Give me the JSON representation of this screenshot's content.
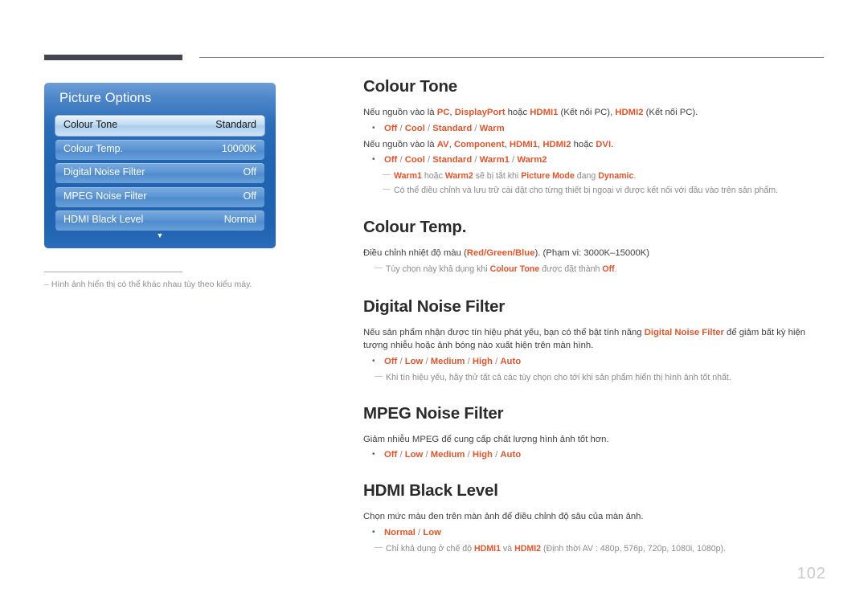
{
  "header": {
    "rule_dark_color": "#45454f",
    "rule_thin_color": "#7a7a84"
  },
  "osd": {
    "title": "Picture Options",
    "scroll_down_icon": "chevron-down-icon",
    "rows": [
      {
        "label": "Colour Tone",
        "value": "Standard",
        "selected": true
      },
      {
        "label": "Colour Temp.",
        "value": "10000K",
        "selected": false
      },
      {
        "label": "Digital Noise Filter",
        "value": "Off",
        "selected": false
      },
      {
        "label": "MPEG Noise Filter",
        "value": "Off",
        "selected": false
      },
      {
        "label": "HDMI Black Level",
        "value": "Normal",
        "selected": false
      }
    ],
    "caption_dash": "–",
    "caption": "Hình ảnh hiển thị có thể khác nhau tùy theo kiểu máy."
  },
  "colors": {
    "accent_orange": "#e2542a",
    "body_text": "#3f3f3f",
    "note_text": "#8b8b8b",
    "heading": "#2b2b2b",
    "osd_blue": "#1f63b1",
    "page_number": "#c9c9cf"
  },
  "sections": {
    "colour_tone": {
      "heading": "Colour Tone",
      "p1_a": "Nếu nguồn vào là ",
      "p1_pc": "PC",
      "p1_b": ", ",
      "p1_displayport": "DisplayPort",
      "p1_c": " hoặc ",
      "p1_hdmi1": "HDMI1",
      "p1_d": " (Kết nối PC), ",
      "p1_hdmi2": "HDMI2",
      "p1_e": " (Kết nối PC).",
      "bullet1": "Off / Cool / Standard / Warm",
      "p2_a": "Nếu nguồn vào là ",
      "p2_av": "AV",
      "p2_b": ", ",
      "p2_component": "Component",
      "p2_c": ", ",
      "p2_hdmi1": "HDMI1",
      "p2_d": ", ",
      "p2_hdmi2": "HDMI2",
      "p2_e": "  hoặc ",
      "p2_dvi": "DVI",
      "p2_f": ".",
      "bullet2": "Off / Cool / Standard / Warm1 / Warm2",
      "note1_warm1": "Warm1",
      "note1_a": " hoặc ",
      "note1_warm2": "Warm2",
      "note1_b": " sẽ bị tắt khi ",
      "note1_picturemode": "Picture Mode",
      "note1_c": " đang ",
      "note1_dynamic": "Dynamic",
      "note1_d": ".",
      "note2": "Có thể điều chỉnh và lưu trữ cài đặt cho từng thiết bị ngoại vi được kết nối với đầu vào trên sản phẩm."
    },
    "colour_temp": {
      "heading": "Colour Temp.",
      "p1_a": "Điều chỉnh nhiệt độ màu (",
      "p1_rgb": "Red/Green/Blue",
      "p1_b": "). (Phạm vi: 3000K–15000K)",
      "note1_a": "Tùy chọn này khả dụng khi ",
      "note1_colourtone": "Colour Tone",
      "note1_b": " được đặt thành ",
      "note1_off": "Off",
      "note1_c": "."
    },
    "digital_noise_filter": {
      "heading": "Digital Noise Filter",
      "p1_a": "Nếu sản phẩm nhận được tín hiệu phát yếu, bạn có thể bật tính năng ",
      "p1_dnf": "Digital Noise Filter",
      "p1_b": " để giảm bất kỳ hiện tượng nhiễu hoặc ảnh bóng nào xuất hiện trên màn hình.",
      "bullet1": "Off / Low / Medium / High / Auto",
      "note1": "Khi tín hiệu yếu, hãy thử tất cả các tùy chọn cho tới khi sản phẩm hiển thị hình ảnh tốt nhất."
    },
    "mpeg_noise_filter": {
      "heading": "MPEG Noise Filter",
      "p1": "Giảm nhiễu MPEG để cung cấp chất lượng hình ảnh tốt hơn.",
      "bullet1": "Off / Low / Medium / High / Auto"
    },
    "hdmi_black_level": {
      "heading": "HDMI Black Level",
      "p1": "Chọn mức màu đen trên màn ảnh để điều chỉnh độ sâu của màn ảnh.",
      "bullet1": "Normal / Low",
      "note1_a": "Chỉ khả dụng ở chế độ ",
      "note1_hdmi1": "HDMI1",
      "note1_b": " và ",
      "note1_hdmi2": "HDMI2",
      "note1_c": " (Định thời AV : 480p, 576p, 720p, 1080i, 1080p)."
    }
  },
  "page_number": "102"
}
